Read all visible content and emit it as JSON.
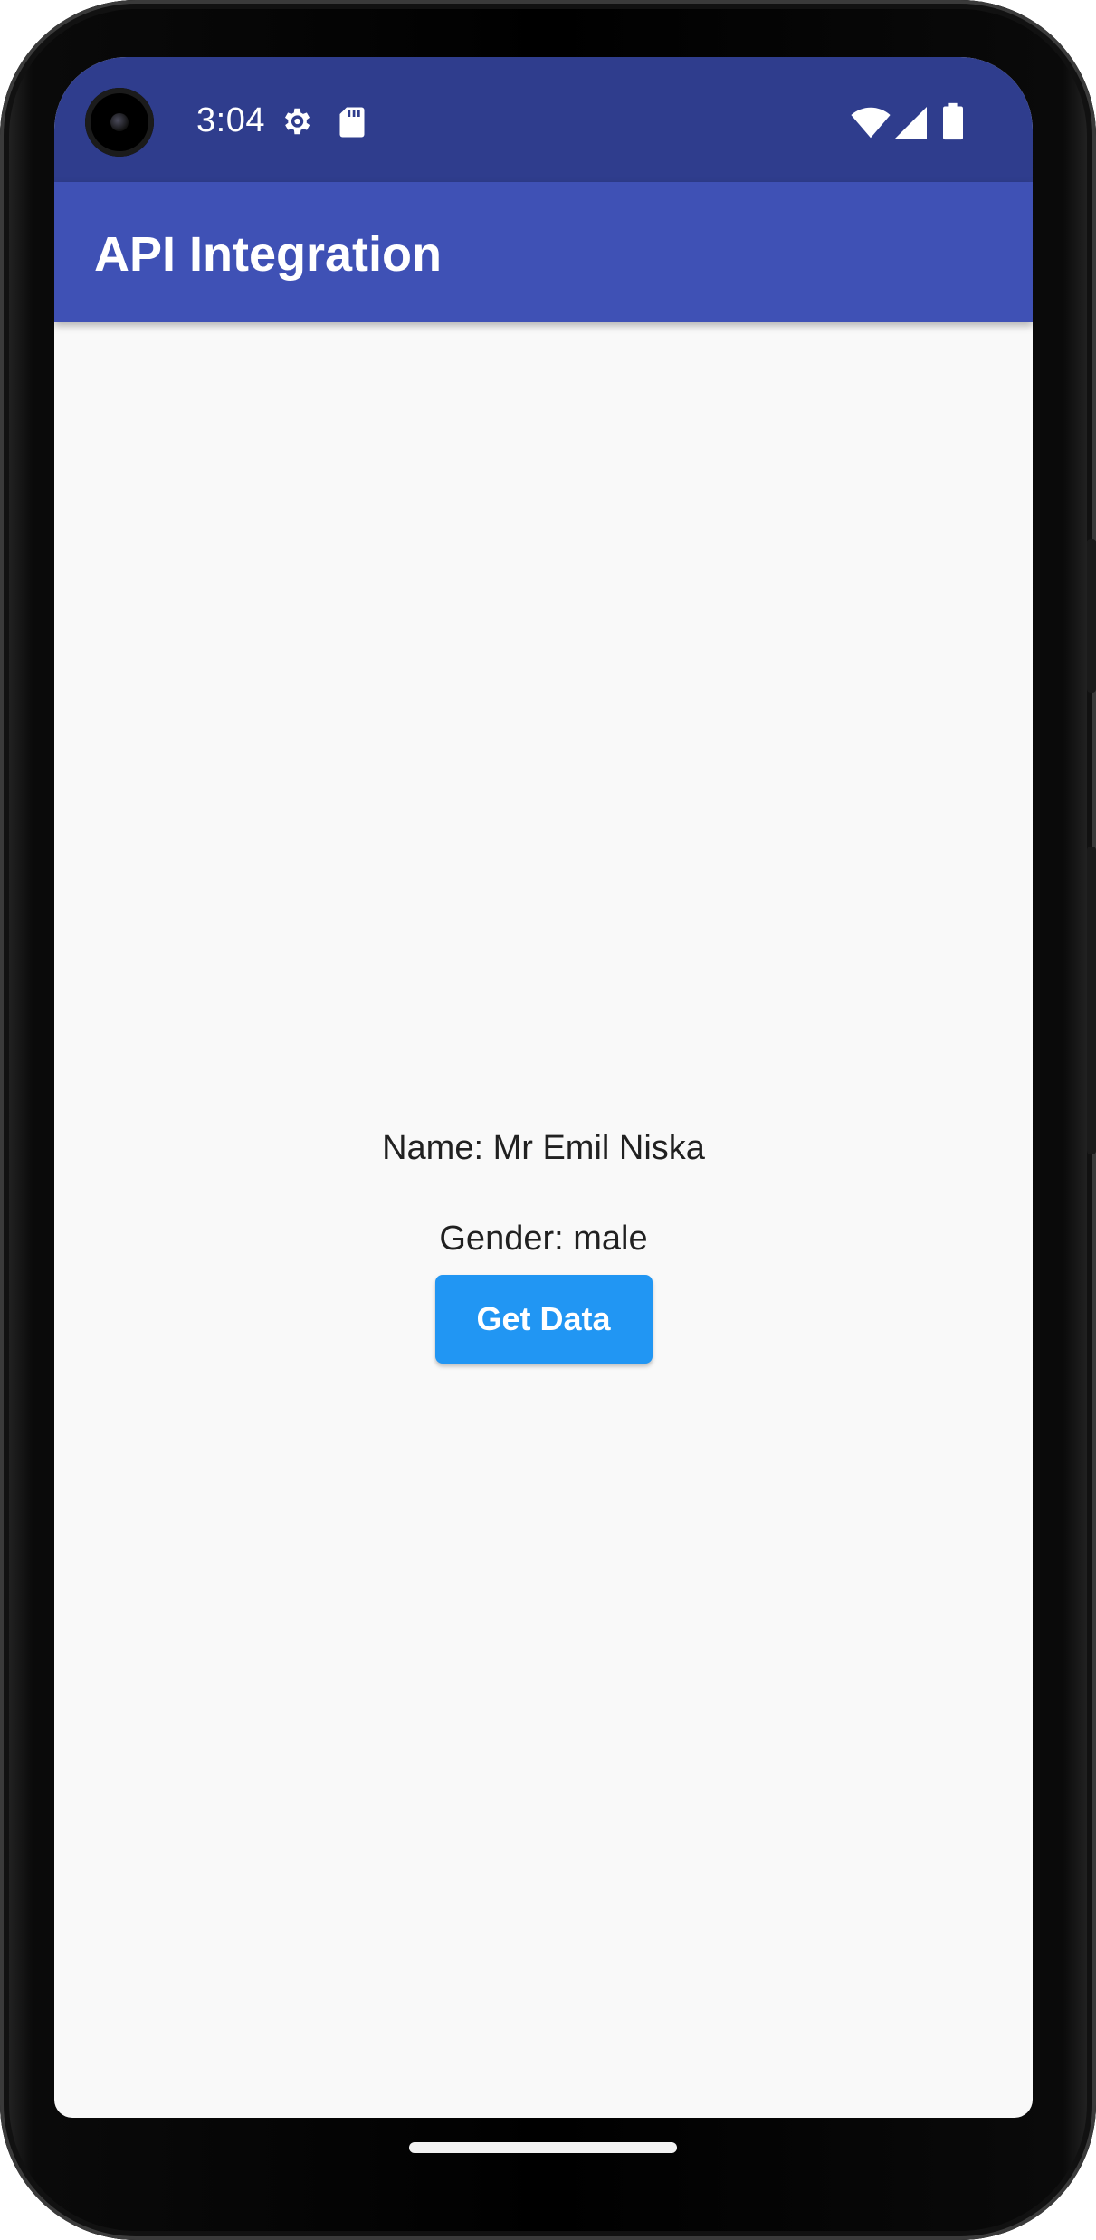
{
  "status_bar": {
    "time": "3:04",
    "icons": [
      "camera-icon",
      "gear-icon",
      "sd-card-icon",
      "wifi-icon",
      "signal-icon",
      "battery-icon"
    ],
    "background_color": "#2f3d8d"
  },
  "app_bar": {
    "title": "API Integration",
    "background_color": "#3f51b5"
  },
  "content": {
    "name_line": "Name: Mr Emil Niska",
    "gender_line": "Gender: male",
    "button_label": "Get Data",
    "button_color": "#2196f3"
  }
}
